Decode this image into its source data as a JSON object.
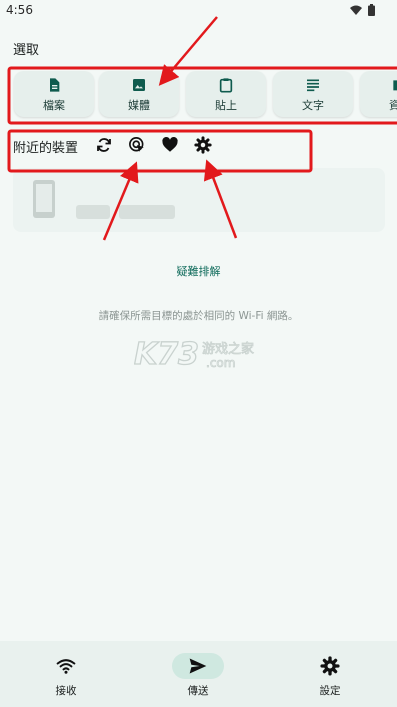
{
  "status_bar": {
    "time": "4:56"
  },
  "select_section": {
    "title": "選取",
    "chips": [
      {
        "label": "檔案",
        "icon": "file-icon"
      },
      {
        "label": "媒體",
        "icon": "image-icon"
      },
      {
        "label": "貼上",
        "icon": "clipboard-icon"
      },
      {
        "label": "文字",
        "icon": "text-icon"
      },
      {
        "label": "資料",
        "icon": "folder-icon"
      }
    ]
  },
  "nearby": {
    "title": "附近的裝置",
    "toolbar_icons": [
      "refresh-icon",
      "target-icon",
      "heart-icon",
      "settings-icon"
    ]
  },
  "troubleshoot_label": "疑難排解",
  "hint_text": "請確保所需目標的處於相同的 Wi-Fi 網路。",
  "watermark": {
    "main": "K73",
    "sub": "游戏之家",
    "domain": ".com"
  },
  "bottom_nav": {
    "items": [
      {
        "label": "接收",
        "icon": "wifi-icon",
        "active": false
      },
      {
        "label": "傳送",
        "icon": "send-icon",
        "active": true
      },
      {
        "label": "設定",
        "icon": "settings-icon",
        "active": false
      }
    ]
  },
  "colors": {
    "accent": "#0f6b5b",
    "annotation": "#e2191c",
    "background": "#f3f8f6",
    "chip_bg": "#e6efec",
    "active_pill": "#cfe8e0"
  }
}
